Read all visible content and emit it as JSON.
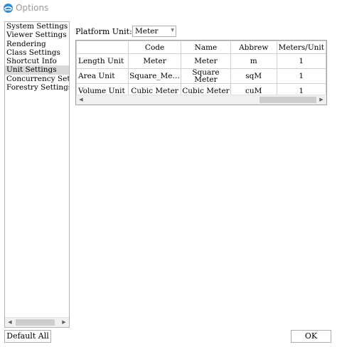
{
  "window": {
    "title": "Options",
    "icon": "app-logo-icon"
  },
  "nav": {
    "items": [
      {
        "label": "System Settings",
        "selected": false
      },
      {
        "label": "Viewer Settings",
        "selected": false
      },
      {
        "label": "Rendering",
        "selected": false
      },
      {
        "label": "Class Settings",
        "selected": false
      },
      {
        "label": "Shortcut Info",
        "selected": false
      },
      {
        "label": "Unit Settings",
        "selected": true
      },
      {
        "label": "Concurrency Settings",
        "selected": false
      },
      {
        "label": "Forestry Settings",
        "selected": false
      }
    ]
  },
  "platform": {
    "label": "Platform Unit:",
    "value": "Meter"
  },
  "table": {
    "columns": [
      "",
      "Code",
      "Name",
      "Abbrew",
      "Meters/Unit"
    ],
    "rows": [
      [
        "Length Unit",
        "Meter",
        "Meter",
        "m",
        "1"
      ],
      [
        "Area Unit",
        "Square_Me…",
        "Square Meter",
        "sqM",
        "1"
      ],
      [
        "Volume Unit",
        "Cubic Meter",
        "Cubic Meter",
        "cuM",
        "1"
      ]
    ]
  },
  "buttons": {
    "default_all": "Default All",
    "ok": "OK"
  },
  "colors": {
    "selection": "#d9d9d9",
    "border": "#adadad",
    "title_text": "#9a9a9a"
  }
}
